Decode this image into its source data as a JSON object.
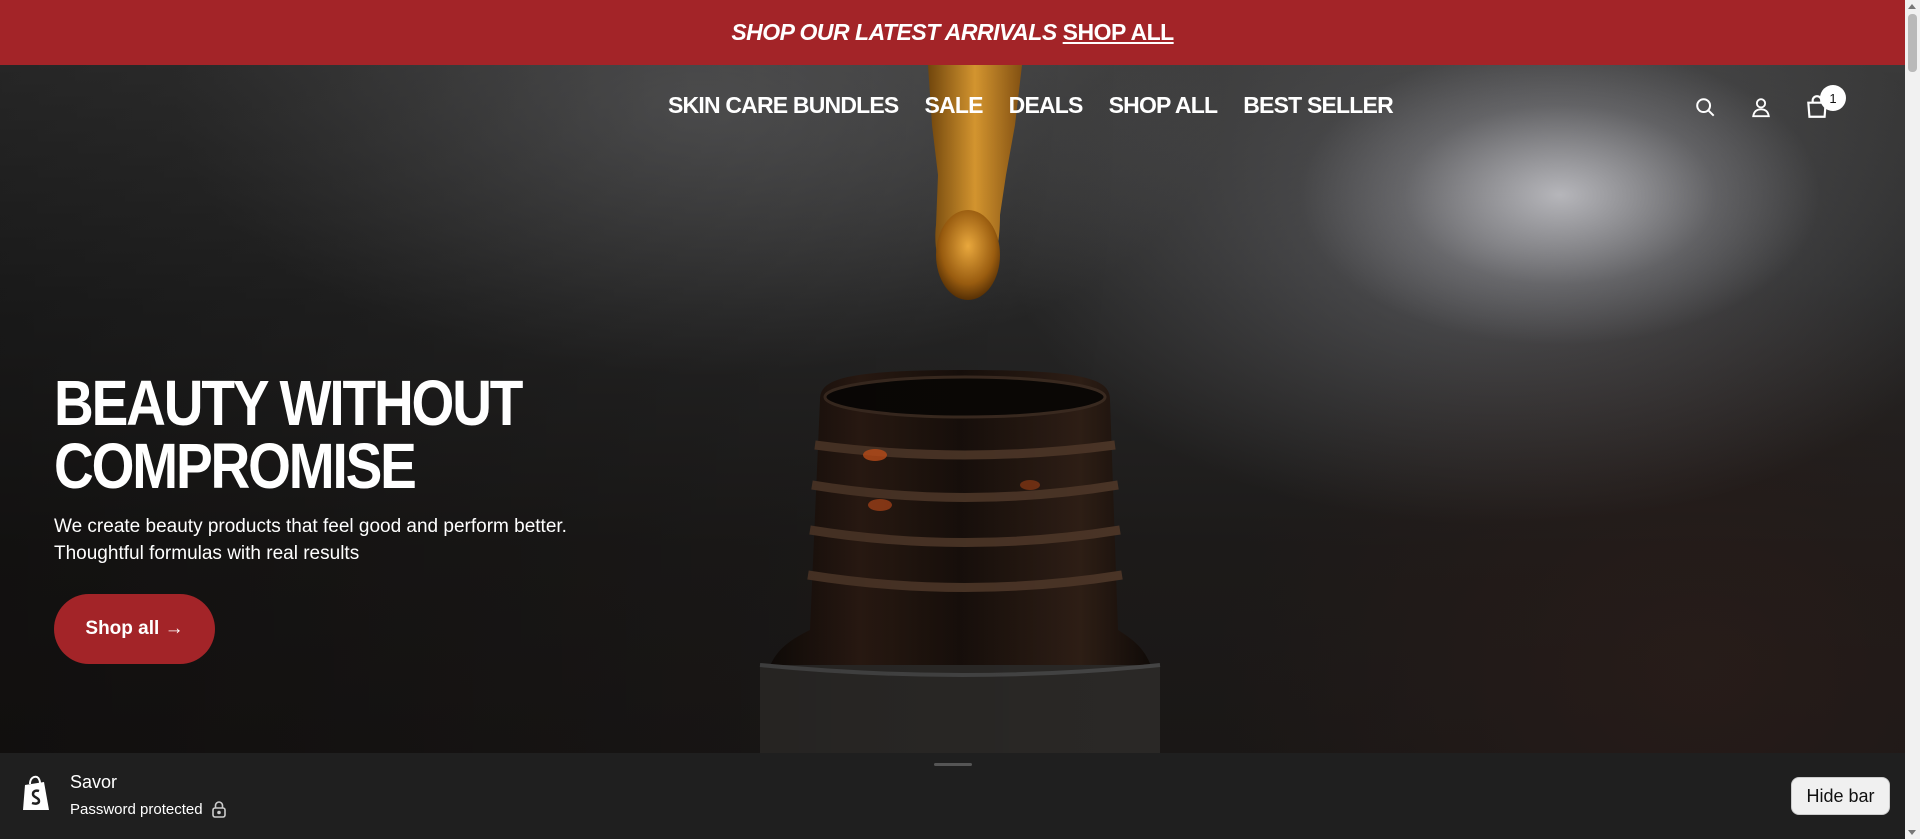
{
  "announcement": {
    "text": "SHOP OUR LATEST ARRIVALS",
    "link": "SHOP ALL"
  },
  "nav": {
    "items": [
      {
        "label": "SKIN CARE BUNDLES"
      },
      {
        "label": "SALE"
      },
      {
        "label": "DEALS"
      },
      {
        "label": "SHOP ALL"
      },
      {
        "label": "BEST SELLER"
      }
    ]
  },
  "header_icons": {
    "search": "search-icon",
    "account": "user-icon",
    "cart": "shopping-bag-icon",
    "cart_count": "1"
  },
  "hero": {
    "title_line1": "BEAUTY WITHOUT",
    "title_line2": "COMPROMISE",
    "subtitle_line1": "We create beauty products that feel good and perform better.",
    "subtitle_line2": "Thoughtful formulas with real results",
    "button_label": "Shop all →"
  },
  "preview_bar": {
    "store_name": "Savor",
    "status": "Password protected",
    "hide_button": "Hide bar"
  },
  "colors": {
    "brand_red": "#a32428",
    "preview_bg": "#1f1f1f"
  }
}
